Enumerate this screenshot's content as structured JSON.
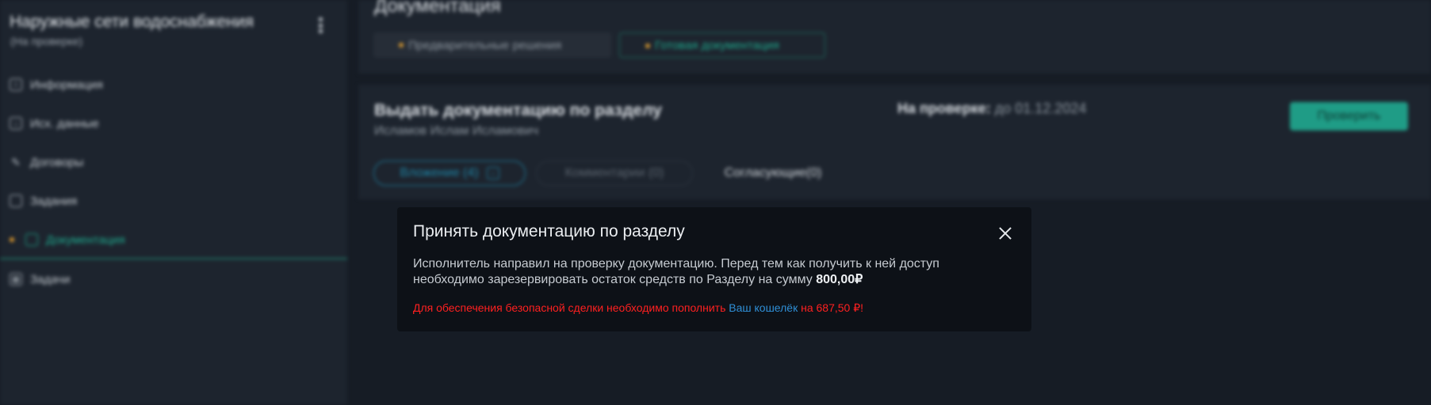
{
  "sidebar": {
    "project_title": "Наружные сети водоснабжения",
    "project_status": "(На проверке)",
    "items": [
      {
        "label": "Информация",
        "icon": "info-icon"
      },
      {
        "label": "Исх. данные",
        "icon": "download-icon"
      },
      {
        "label": "Договоры",
        "icon": "pen-icon"
      },
      {
        "label": "Задания",
        "icon": "window-icon"
      },
      {
        "label": "Документация",
        "icon": "document-icon",
        "active": true
      },
      {
        "label": "Задачи",
        "icon": "grid-icon"
      }
    ]
  },
  "main": {
    "title": "Документация",
    "tabs": [
      {
        "label": "Предварительные решения"
      },
      {
        "label": "Готовая документация",
        "active": true
      }
    ],
    "card": {
      "title": "Выдать документацию по разделу",
      "author": "Исламов Ислам Исламович",
      "status_label": "На проверке:",
      "status_date": "до 01.12.2024",
      "check_button": "Проверить",
      "subtabs": {
        "attachment": "Вложение (4)",
        "comments": "Комментарии (0)",
        "approvers": "Согласующие(0)"
      }
    }
  },
  "dialog": {
    "title": "Принять документацию по разделу",
    "text": "Исполнитель направил на проверку документацию. Перед тем как получить к ней доступ необходимо зарезервировать остаток средств по Разделу на сумму ",
    "amount": "800,00₽",
    "warning_prefix": "Для обеспечения безопасной сделки необходимо пополнить ",
    "warning_link": "Ваш кошелёк",
    "warning_suffix": " на 687,50 ₽!"
  },
  "colors": {
    "accent": "#1fa88c",
    "link": "#2f8fd6",
    "warning": "#ff2020",
    "bullet": "#e09a2b"
  }
}
